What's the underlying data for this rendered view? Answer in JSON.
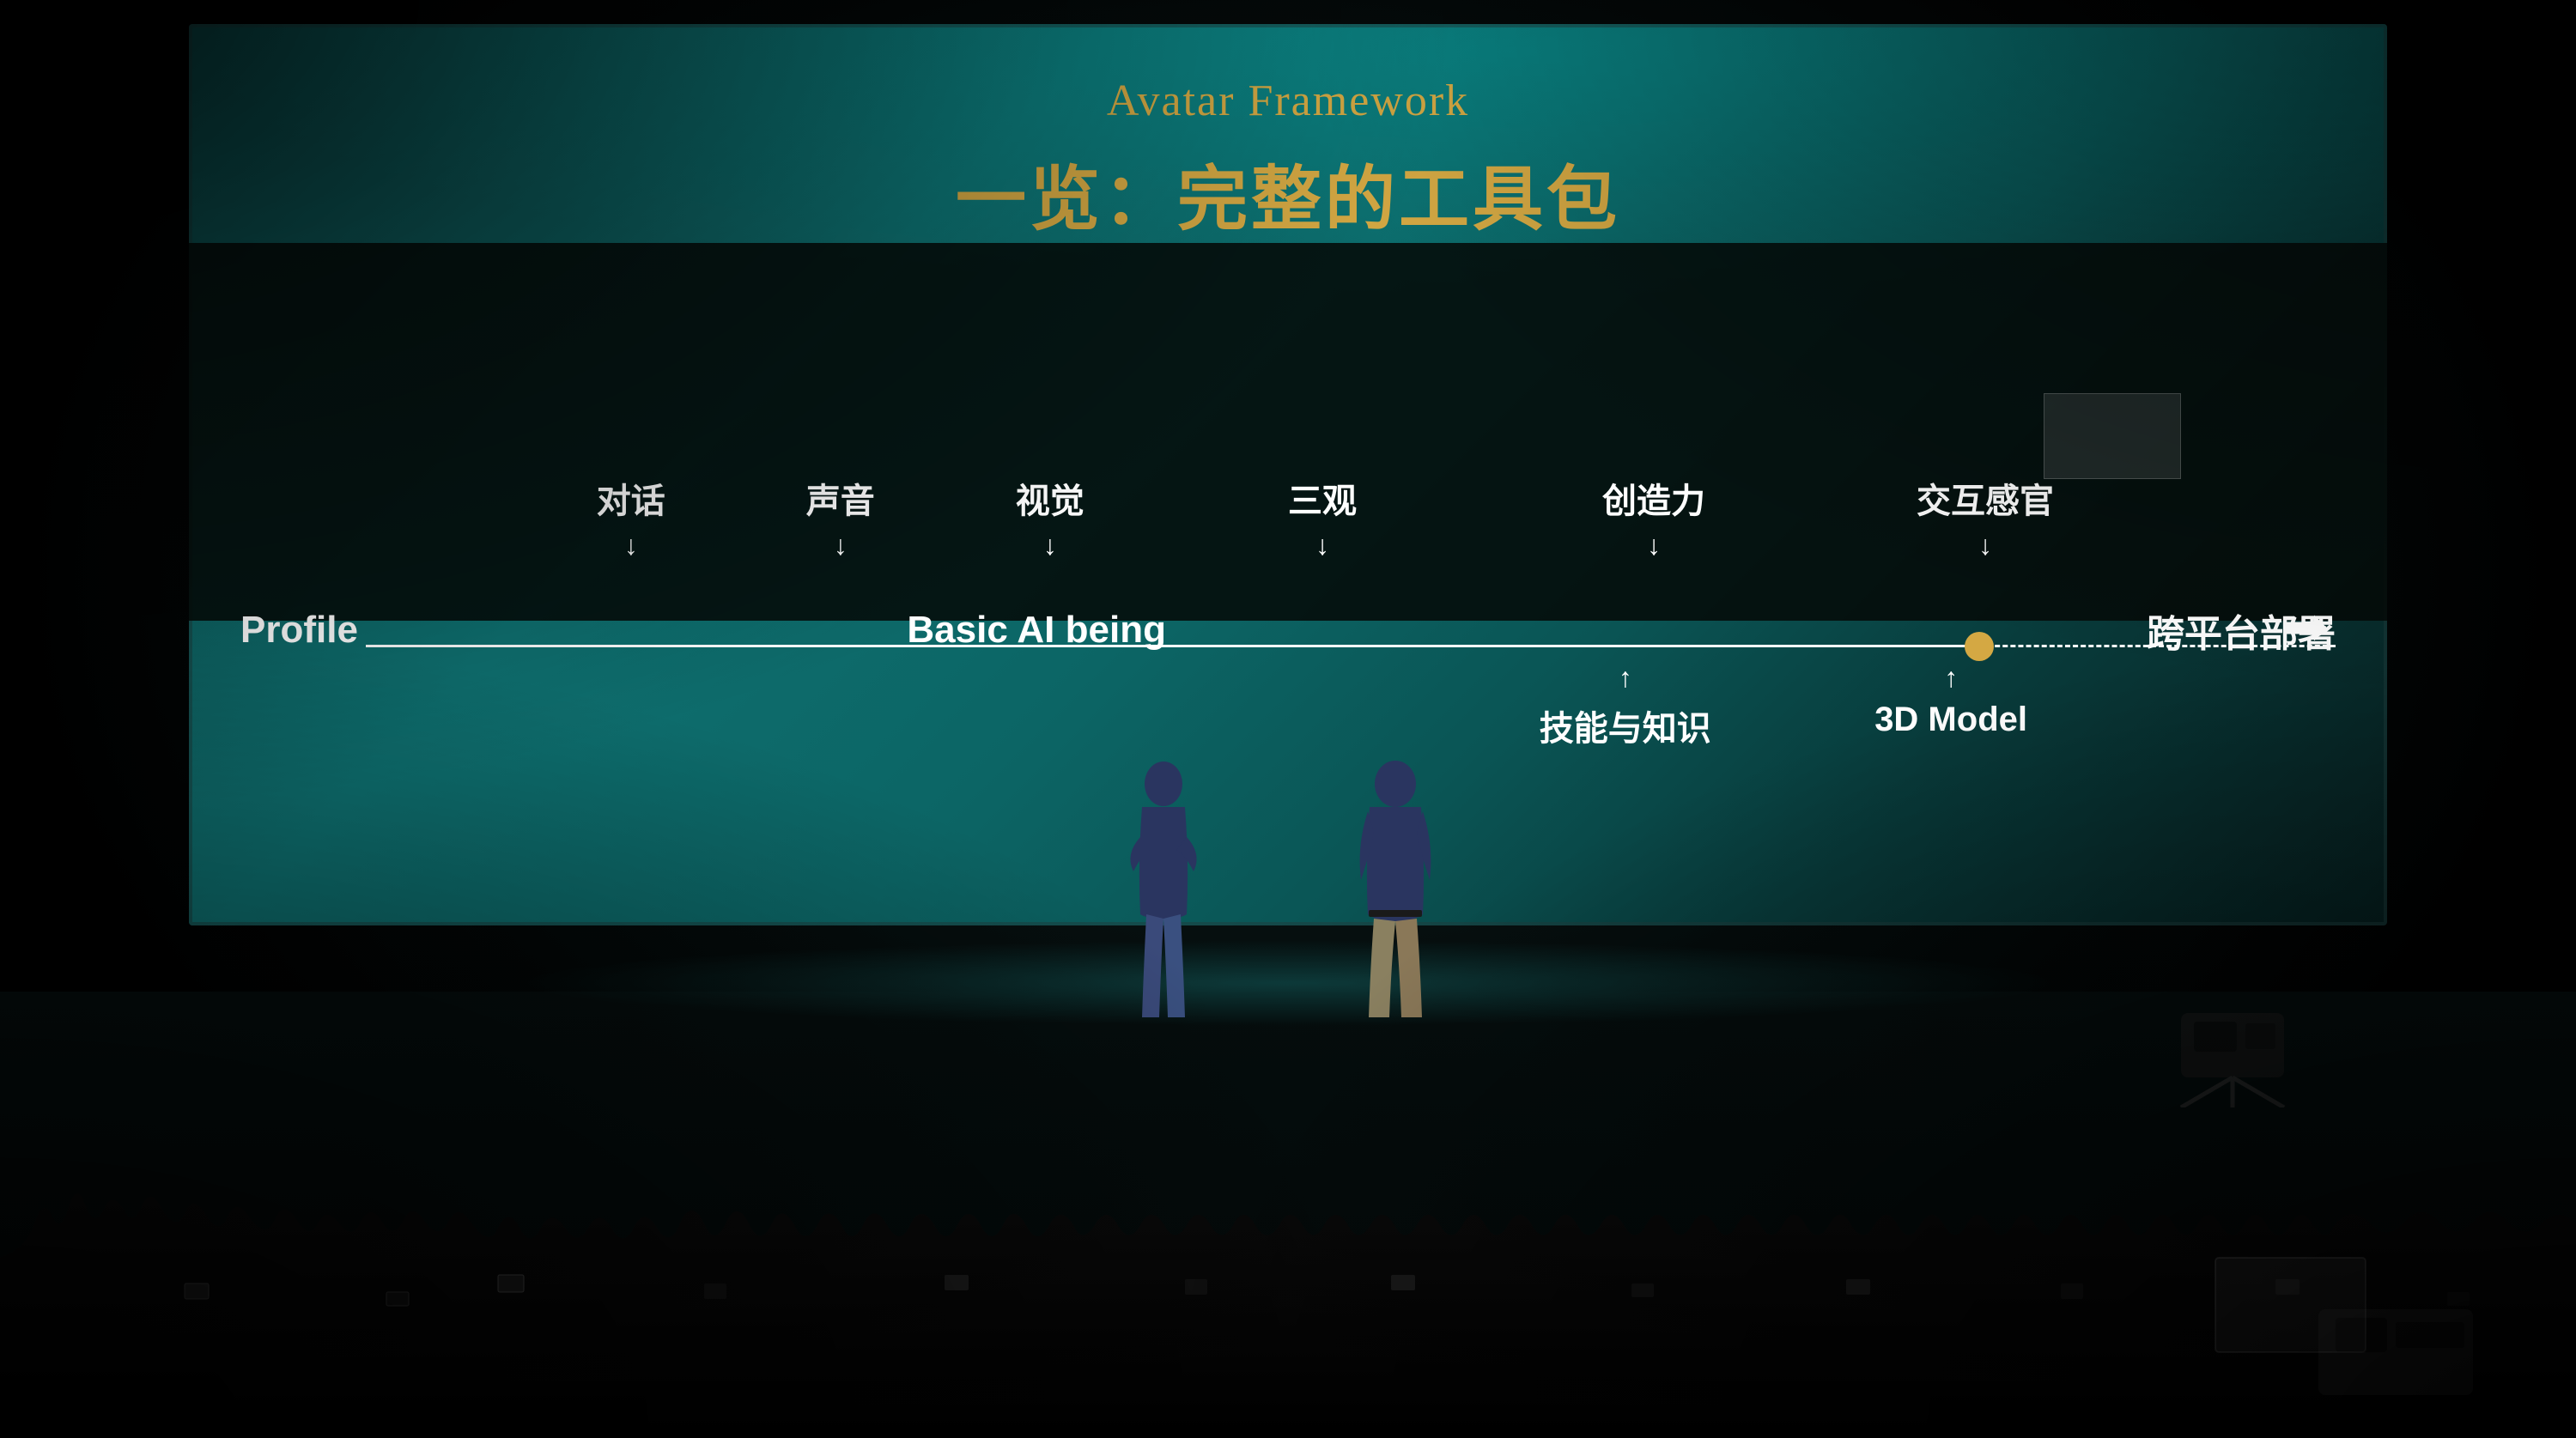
{
  "scene": {
    "background": "#000000"
  },
  "screen": {
    "title_en": "Avatar Framework",
    "title_zh": "一览：完整的工具包",
    "diagram": {
      "left_label": "Profile",
      "center_label": "Basic AI being",
      "right_label": "跨平台部署",
      "above_labels": [
        {
          "text": "对话",
          "left_pct": 19
        },
        {
          "text": "声音",
          "left_pct": 30
        },
        {
          "text": "视觉",
          "left_pct": 40
        },
        {
          "text": "三观",
          "left_pct": 53
        },
        {
          "text": "创造力",
          "left_pct": 68
        },
        {
          "text": "交互感官",
          "left_pct": 84
        }
      ],
      "below_labels": [
        {
          "text": "技能与知识",
          "left_pct": 68
        },
        {
          "text": "3D Model",
          "left_pct": 82
        }
      ]
    }
  }
}
